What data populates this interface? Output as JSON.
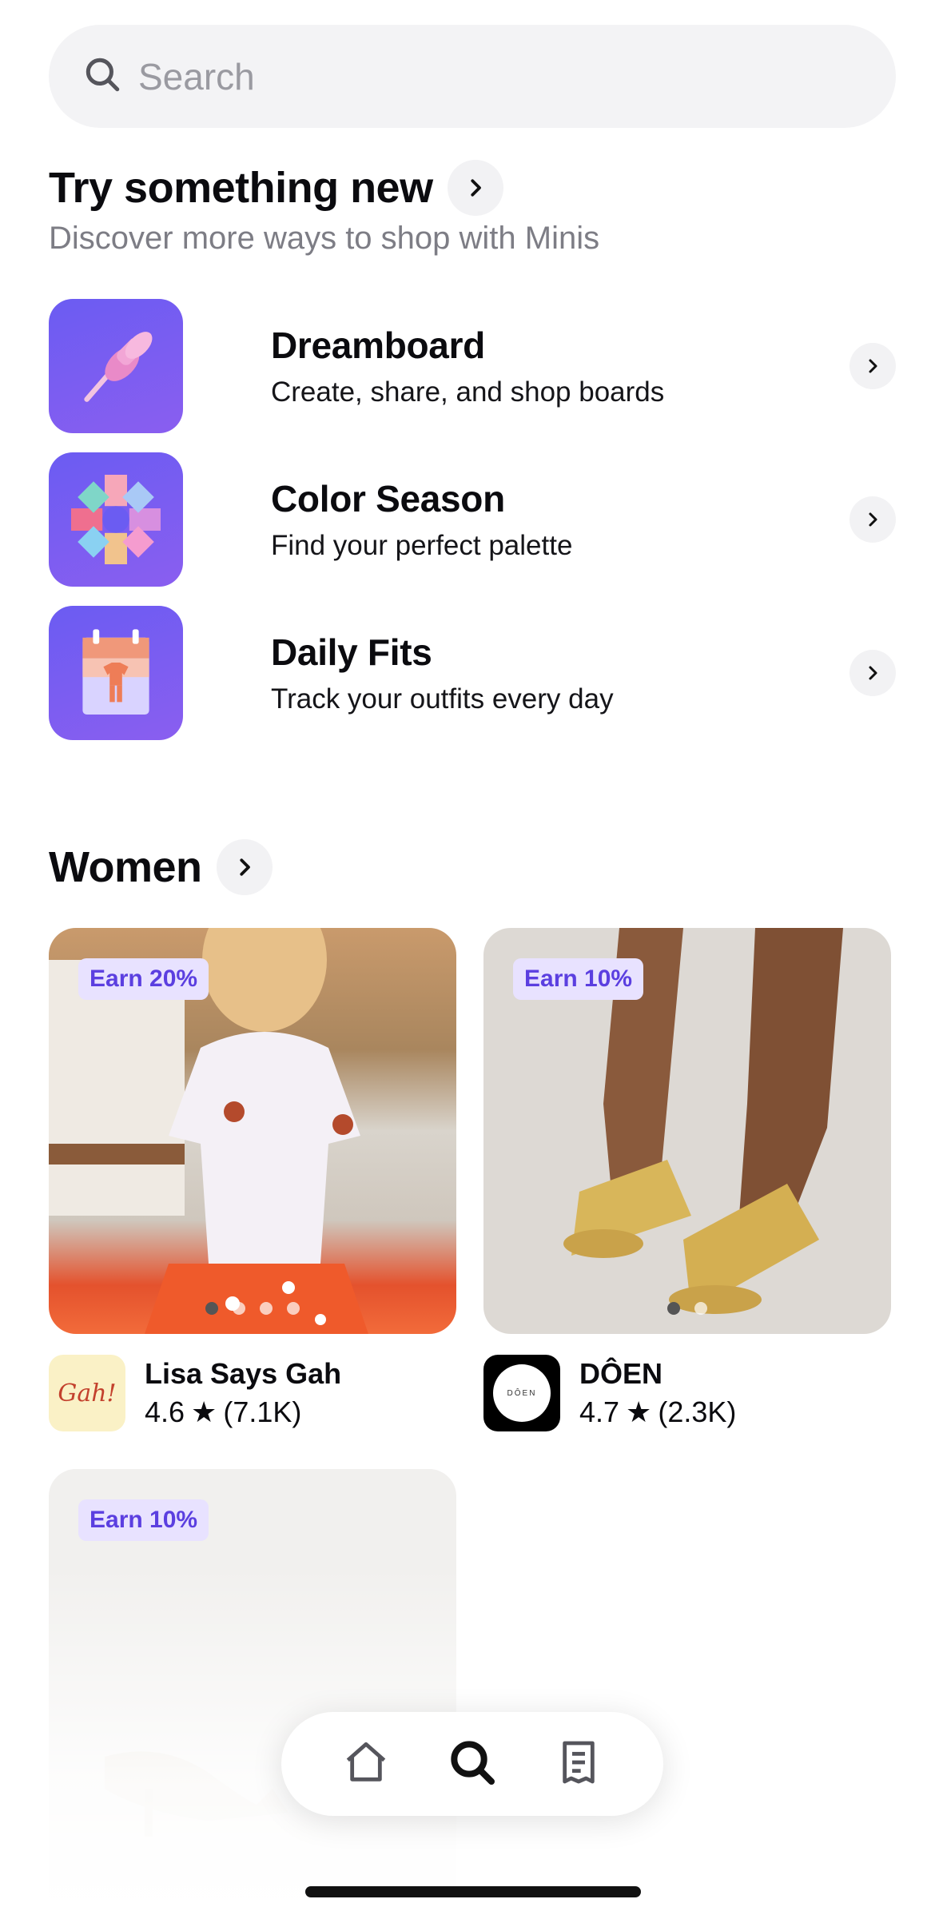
{
  "search": {
    "placeholder": "Search"
  },
  "try_section": {
    "title": "Try something new",
    "subtitle": "Discover more ways to shop with Minis",
    "items": [
      {
        "title": "Dreamboard",
        "description": "Create, share, and shop boards",
        "icon": "pushpin-icon"
      },
      {
        "title": "Color Season",
        "description": "Find your perfect palette",
        "icon": "color-wheel-icon"
      },
      {
        "title": "Daily Fits",
        "description": "Track your outfits every day",
        "icon": "calendar-outfit-icon"
      }
    ]
  },
  "women_section": {
    "title": "Women",
    "products": [
      {
        "earn": "Earn 20%",
        "shop_name": "Lisa Says Gah",
        "rating": "4.6",
        "reviews": "(7.1K)",
        "logo_text": "Gah!",
        "image_dots": 4,
        "active_dot": 0
      },
      {
        "earn": "Earn 10%",
        "shop_name": "DÔEN",
        "rating": "4.7",
        "reviews": "(2.3K)",
        "logo_text": "DÔEN",
        "image_dots": 2,
        "active_dot": 0
      },
      {
        "earn": "Earn 10%"
      }
    ]
  },
  "bottom_nav": {
    "items": [
      {
        "name": "Home",
        "icon": "home-icon",
        "active": false
      },
      {
        "name": "Search",
        "icon": "search-icon",
        "active": true
      },
      {
        "name": "Orders",
        "icon": "receipt-icon",
        "active": false
      }
    ]
  },
  "colors": {
    "accent": "#6b5cf2",
    "earn_badge_bg": "#e8e2ff",
    "earn_badge_text": "#5b3fe0"
  }
}
